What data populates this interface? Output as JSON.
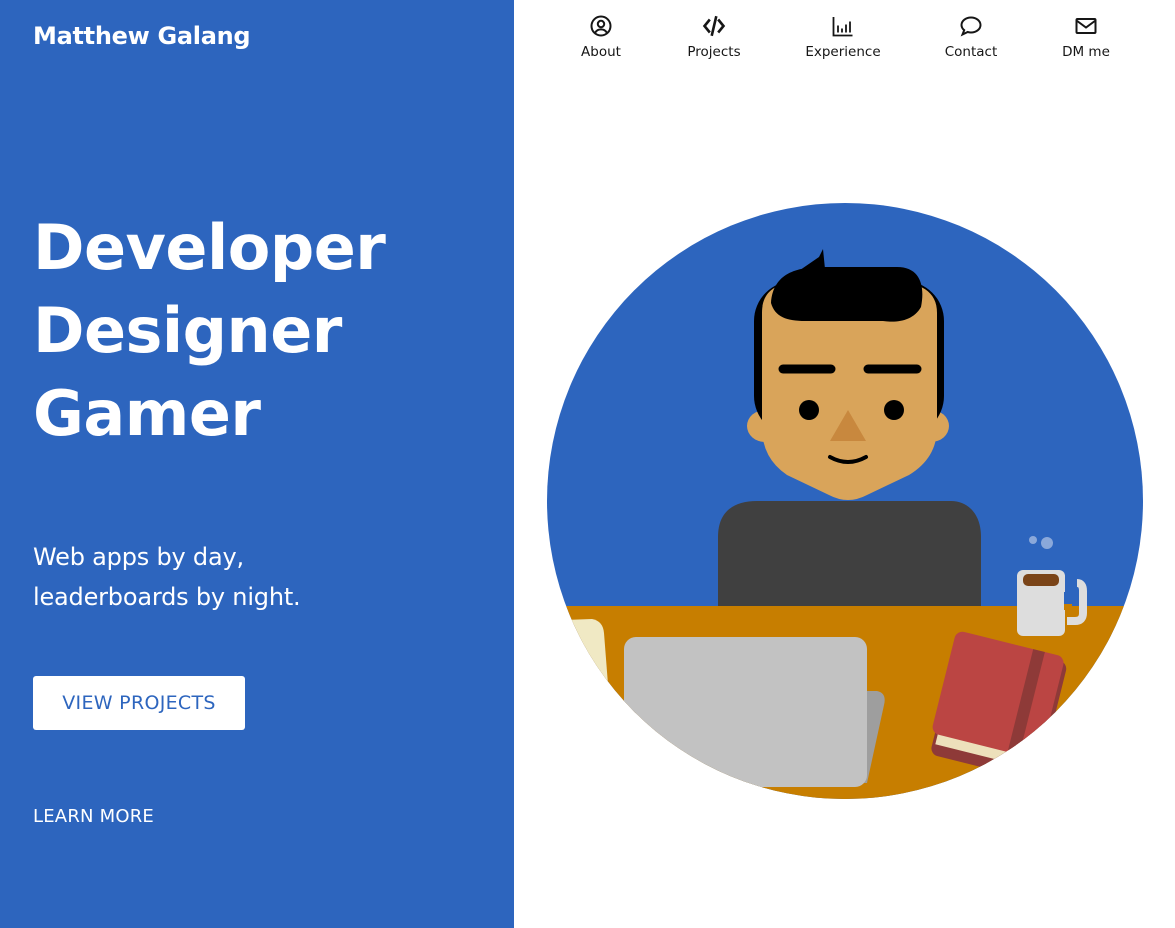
{
  "site": {
    "brand": "Matthew Galang"
  },
  "hero": {
    "headline": [
      "Developer",
      "Designer",
      "Gamer"
    ],
    "tagline": [
      "Web apps by day,",
      "leaderboards by night."
    ],
    "cta_label": "VIEW PROJECTS",
    "learn_more_label": "LEARN MORE"
  },
  "nav": {
    "items": [
      {
        "label": "About",
        "icon": "user-circle-icon"
      },
      {
        "label": "Projects",
        "icon": "code-icon"
      },
      {
        "label": "Experience",
        "icon": "bar-chart-icon"
      },
      {
        "label": "Contact",
        "icon": "chat-bubble-icon"
      },
      {
        "label": "DM me",
        "icon": "mail-icon"
      }
    ]
  },
  "colors": {
    "brand_blue": "#2d65be",
    "desk": "#c77e00",
    "skin": "#d9a45a",
    "shirt": "#404040"
  }
}
